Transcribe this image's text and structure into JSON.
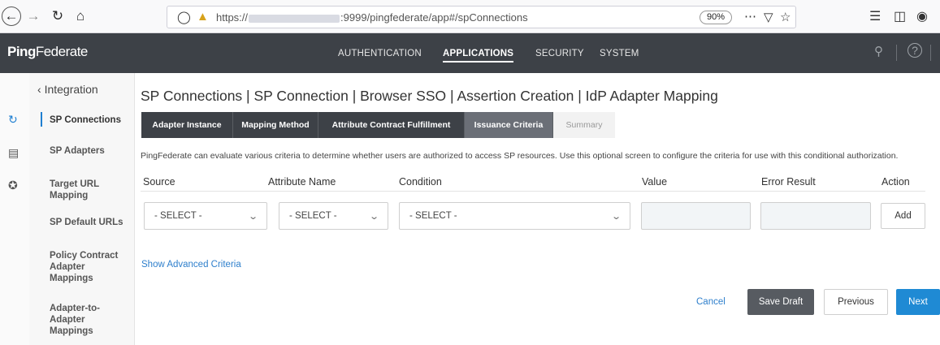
{
  "browser": {
    "url_prefix": "https://",
    "url_suffix": ":9999/pingfederate/app#/spConnections",
    "zoom": "90%"
  },
  "header": {
    "logo_bold": "Ping",
    "logo_rest": "Federate",
    "nav": [
      "AUTHENTICATION",
      "APPLICATIONS",
      "SECURITY",
      "SYSTEM"
    ],
    "active_nav": "APPLICATIONS"
  },
  "sidebar": {
    "back_label": "Integration",
    "items": [
      {
        "label": "SP Connections"
      },
      {
        "label": "SP Adapters"
      },
      {
        "label": "Target URL Mapping"
      },
      {
        "label": "SP Default URLs"
      },
      {
        "label": "Policy Contract Adapter Mappings"
      },
      {
        "label": "Adapter-to-Adapter Mappings"
      }
    ]
  },
  "page": {
    "title": "SP Connections | SP Connection | Browser SSO | Assertion Creation | IdP Adapter Mapping",
    "tabs": [
      {
        "label": "Adapter Instance"
      },
      {
        "label": "Mapping Method"
      },
      {
        "label": "Attribute Contract Fulfillment"
      },
      {
        "label": "Issuance Criteria"
      },
      {
        "label": "Summary"
      }
    ],
    "description": "PingFederate can evaluate various criteria to determine whether users are authorized to access SP resources. Use this optional screen to configure the criteria for use with this conditional authorization.",
    "columns": [
      "Source",
      "Attribute Name",
      "Condition",
      "Value",
      "Error Result",
      "Action"
    ],
    "row": {
      "source": "- SELECT -",
      "attribute": "- SELECT -",
      "condition": "- SELECT -",
      "value": "",
      "error_result": "",
      "add_label": "Add"
    },
    "advanced_link": "Show Advanced Criteria"
  },
  "footer": {
    "cancel": "Cancel",
    "save_draft": "Save Draft",
    "previous": "Previous",
    "next": "Next"
  },
  "colors": {
    "header_bg": "#3d4147",
    "accent": "#1f8ad4",
    "link": "#2e7fcc"
  }
}
